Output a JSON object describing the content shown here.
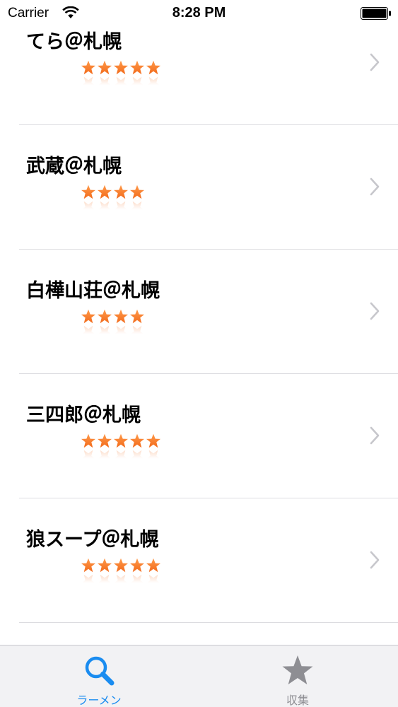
{
  "status_bar": {
    "carrier": "Carrier",
    "time": "8:28 PM"
  },
  "list": {
    "items": [
      {
        "name": "てら＠札幌",
        "rating": 5
      },
      {
        "name": "武蔵＠札幌",
        "rating": 4
      },
      {
        "name": "白樺山荘＠札幌",
        "rating": 4
      },
      {
        "name": "三四郎＠札幌",
        "rating": 5
      },
      {
        "name": "狼スープ＠札幌",
        "rating": 5
      }
    ]
  },
  "tab_bar": {
    "tabs": [
      {
        "label": "ラーメン",
        "icon": "search-icon",
        "active": true
      },
      {
        "label": "収集",
        "icon": "star-icon",
        "active": false
      }
    ]
  },
  "colors": {
    "accent": "#1a8cf0",
    "star": "#f26a1b",
    "chevron": "#c7c7cc",
    "inactive": "#8e8e93"
  }
}
